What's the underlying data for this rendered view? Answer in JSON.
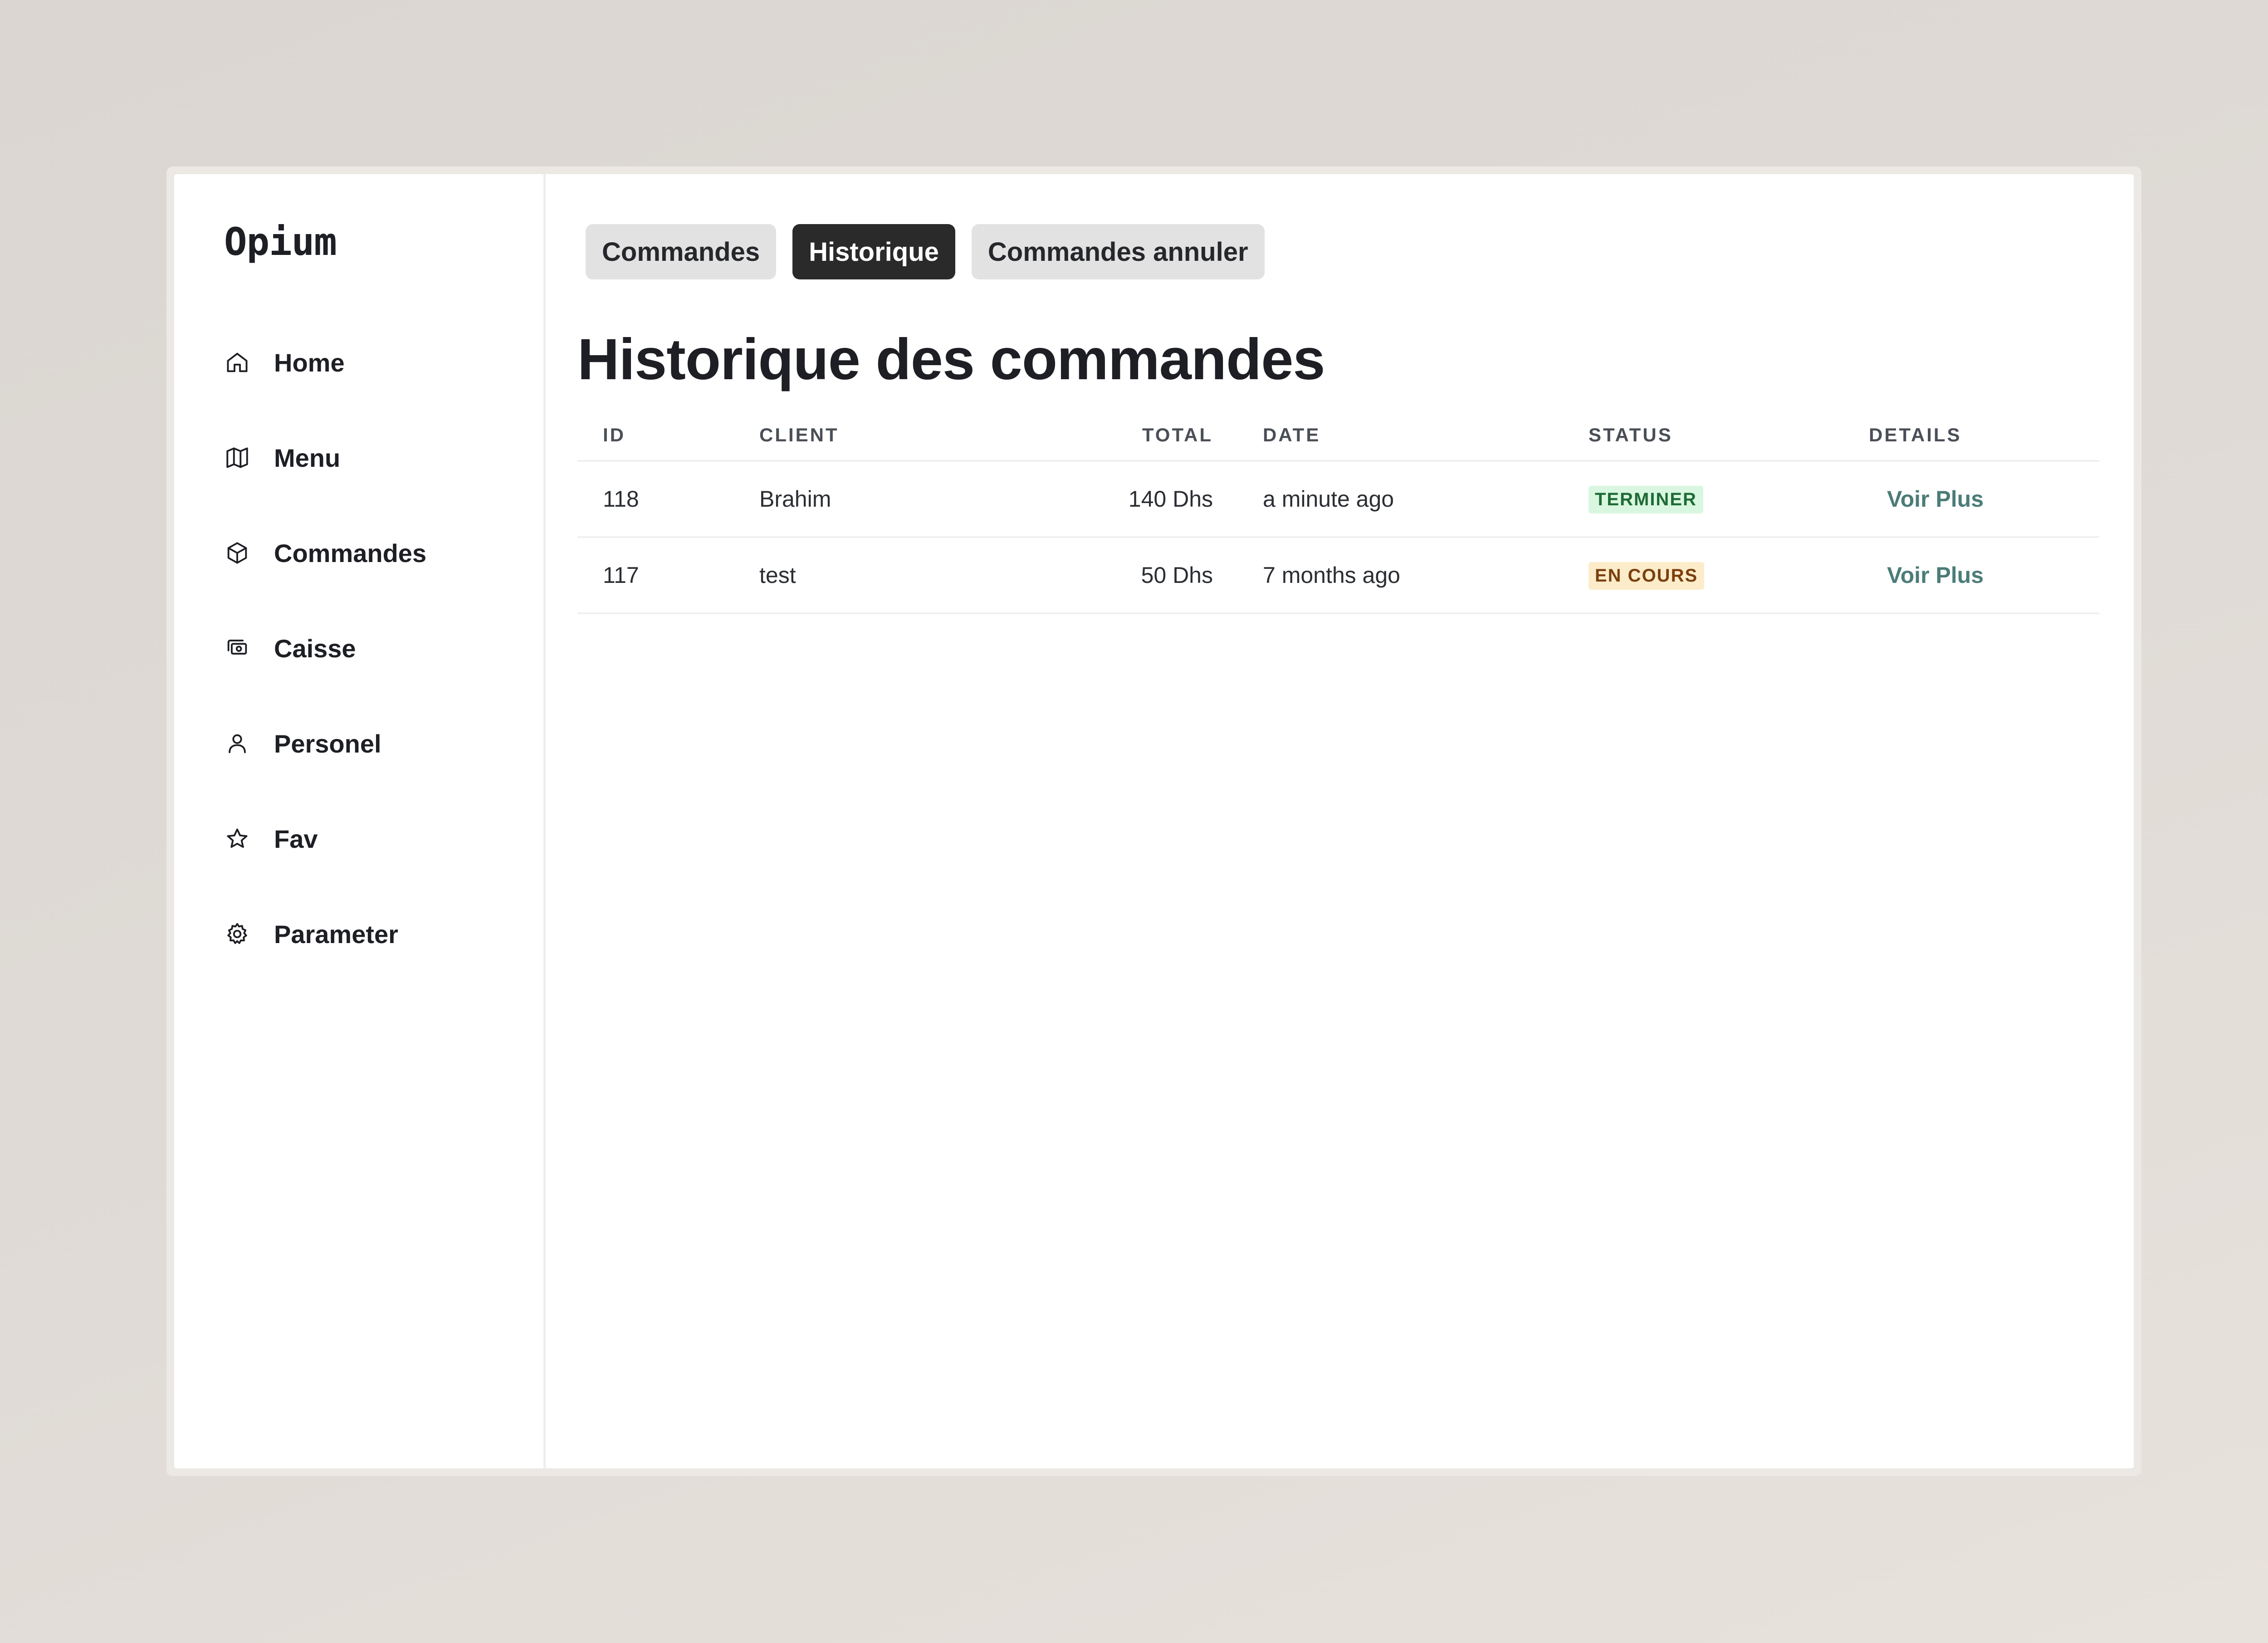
{
  "app": {
    "logo": "Opium"
  },
  "sidebar": {
    "items": [
      {
        "label": "Home",
        "icon": "home-icon"
      },
      {
        "label": "Menu",
        "icon": "map-icon"
      },
      {
        "label": "Commandes",
        "icon": "box-icon"
      },
      {
        "label": "Caisse",
        "icon": "cash-icon"
      },
      {
        "label": "Personel",
        "icon": "user-icon"
      },
      {
        "label": "Fav",
        "icon": "star-icon"
      },
      {
        "label": "Parameter",
        "icon": "gear-icon"
      }
    ]
  },
  "tabs": [
    {
      "label": "Commandes",
      "active": false
    },
    {
      "label": "Historique",
      "active": true
    },
    {
      "label": "Commandes annuler",
      "active": false
    }
  ],
  "main": {
    "title": "Historique des commandes"
  },
  "table": {
    "headers": {
      "id": "ID",
      "client": "CLIENT",
      "total": "TOTAL",
      "date": "DATE",
      "status": "STATUS",
      "details": "DETAILS"
    },
    "rows": [
      {
        "id": "118",
        "client": "Brahim",
        "total": "140 Dhs",
        "date": "a minute ago",
        "status": "TERMINER",
        "details": "Voir Plus"
      },
      {
        "id": "117",
        "client": "test",
        "total": "50 Dhs",
        "date": "7 months ago",
        "status": "EN COURS",
        "details": "Voir Plus"
      }
    ]
  },
  "colors": {
    "accent_link": "#4b7c78",
    "badge_done_bg": "#d9f7e0",
    "badge_done_text": "#1f6b35",
    "badge_progress_bg": "#fcecc9",
    "badge_progress_text": "#7a3f0e",
    "tab_active_bg": "#2a2a2a"
  }
}
